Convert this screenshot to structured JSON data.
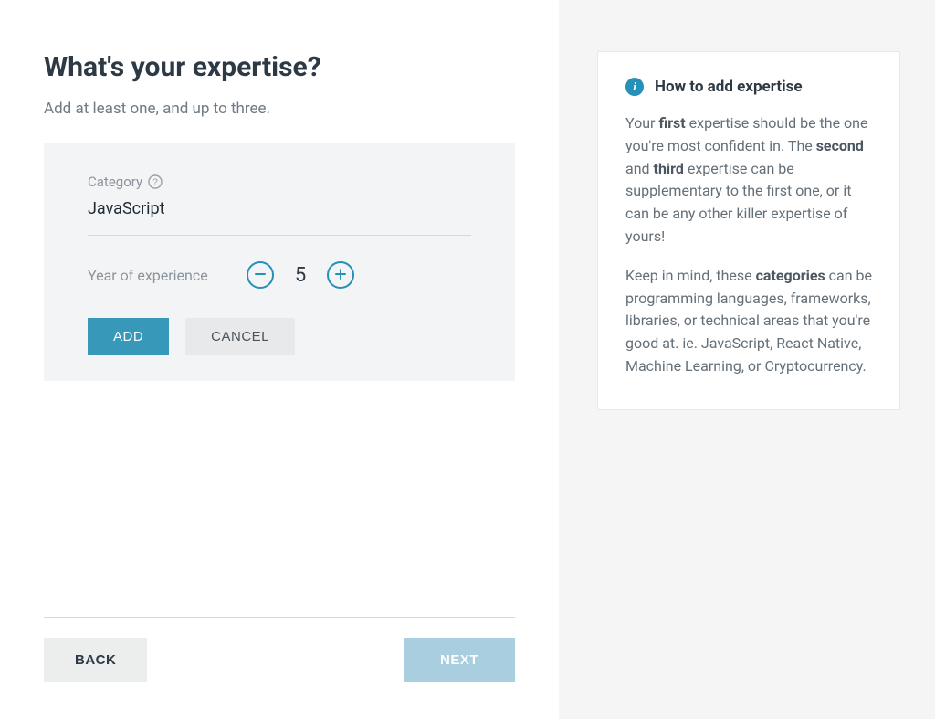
{
  "main": {
    "title": "What's your expertise?",
    "subtitle": "Add at least one, and up to three.",
    "card": {
      "category_label": "Category",
      "category_value": "JavaScript",
      "years_label": "Year of experience",
      "years_value": "5",
      "add_label": "ADD",
      "cancel_label": "CANCEL"
    },
    "nav": {
      "back_label": "BACK",
      "next_label": "NEXT"
    }
  },
  "sidebar": {
    "title": "How to add expertise",
    "para1_prefix": "Your ",
    "para1_bold1": "first",
    "para1_mid1": " expertise should be the one you're most confident in. The ",
    "para1_bold2": "second",
    "para1_mid2": " and ",
    "para1_bold3": "third",
    "para1_suffix": " expertise can be supplementary to the first one, or it can be any other killer expertise of yours!",
    "para2_prefix": "Keep in mind, these ",
    "para2_bold1": "categories",
    "para2_suffix": " can be programming languages, frameworks, libraries, or technical areas that you're good at. ie. JavaScript, React Native, Machine Learning, or Cryptocurrency."
  },
  "icons": {
    "help": "?",
    "info": "i"
  }
}
